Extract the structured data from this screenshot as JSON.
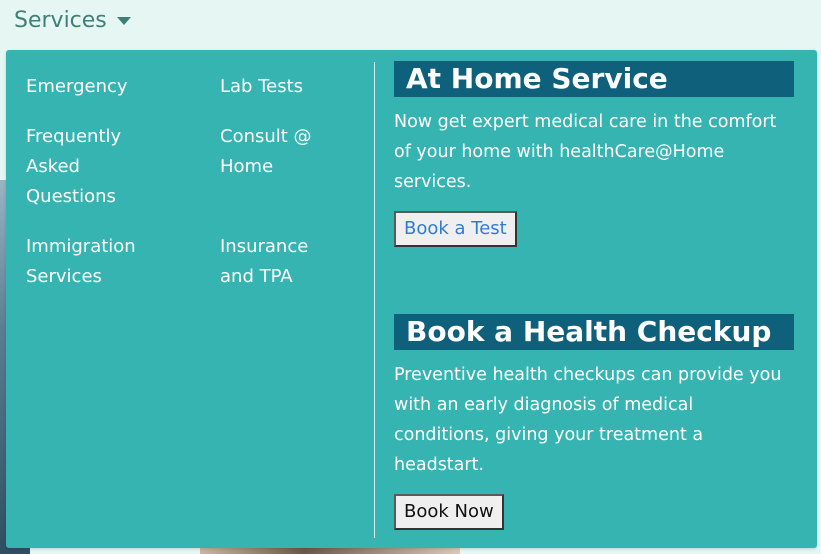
{
  "nav": {
    "trigger_label": "Services",
    "caret_icon": "caret-down-icon"
  },
  "menu": {
    "links_col1": [
      {
        "label": "Emergency"
      },
      {
        "label": "Frequently\nAsked\nQuestions"
      },
      {
        "label": "Immigration\nServices"
      }
    ],
    "links_col2": [
      {
        "label": "Lab Tests"
      },
      {
        "label": "Consult @\nHome"
      },
      {
        "label": "Insurance\nand TPA"
      }
    ],
    "promo1": {
      "title": "At Home Service",
      "text": "Now get expert medical care in the comfort of your home with healthCare@Home services.",
      "button_label": "Book a Test"
    },
    "promo2": {
      "title": "Book a Health Checkup",
      "text": "Preventive health checkups can provide you with an early diagnosis of medical conditions, giving your treatment a headstart.",
      "button_label": "Book Now"
    }
  },
  "colors": {
    "menu_bg": "#36b4b2",
    "title_bg": "#0f607a",
    "nav_text": "#3e7f78",
    "link_button_text": "#2e7cd6"
  }
}
